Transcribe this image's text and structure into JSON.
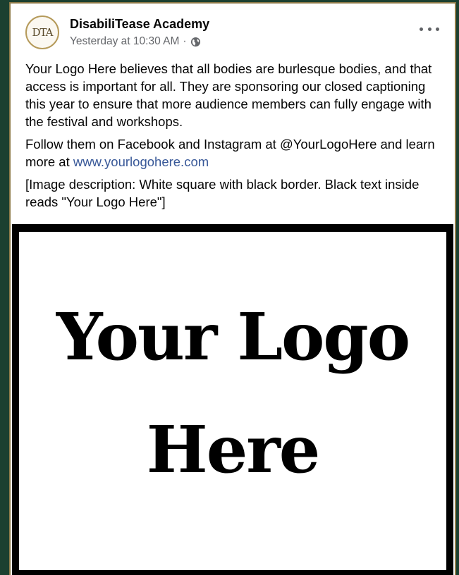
{
  "post": {
    "page_name": "DisabiliTease Academy",
    "avatar_text": "DTA",
    "timestamp": "Yesterday at 10:30 AM",
    "separator": "·",
    "privacy_icon": "globe-icon",
    "more_icon": "ellipsis-icon",
    "paragraph1": "Your Logo Here believes that all bodies are burlesque bodies, and that access is important for all. They are sponsoring our closed captioning this year to ensure that more audience members can fully engage with the festival and workshops.",
    "paragraph2_text": "Follow them on Facebook and Instagram at @YourLogoHere and learn more at ",
    "paragraph2_link": "www.yourlogohere.com",
    "paragraph3": "[Image description: White square with black border. Black text inside reads \"Your Logo Here\"]",
    "image": {
      "line1": "Your Logo",
      "line2": "Here"
    }
  },
  "colors": {
    "background": "#1c4030",
    "card_border": "#8e7a48",
    "link": "#385898",
    "meta_text": "#65676b"
  }
}
